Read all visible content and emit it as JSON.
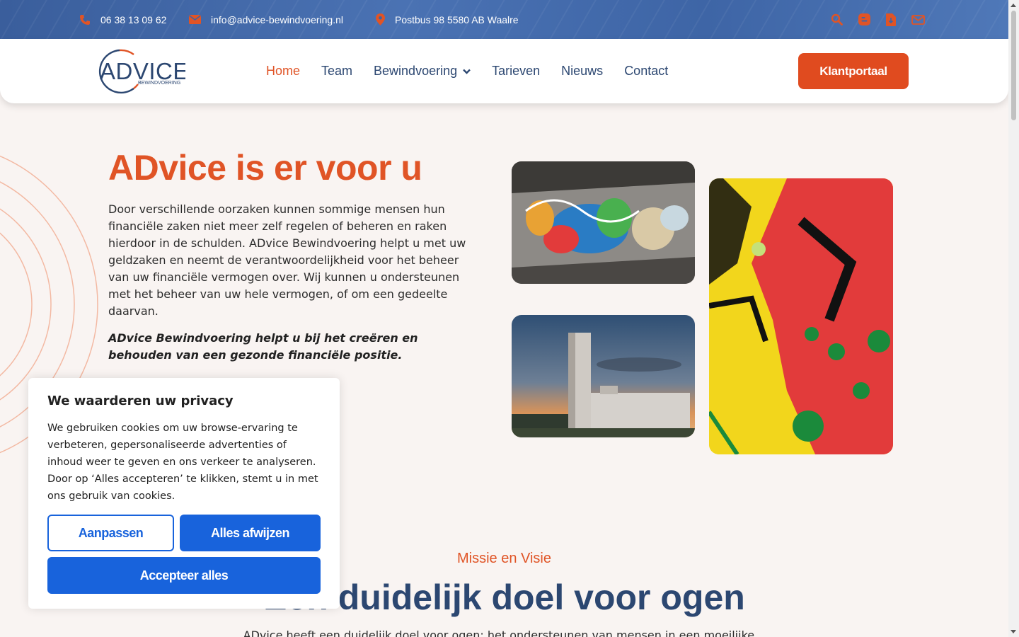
{
  "topbar": {
    "phone": "06 38 13 09 62",
    "email": "info@advice-bewindvoering.nl",
    "address": "Postbus 98 5580 AB Waalre",
    "icons": [
      "search-icon",
      "blogger-icon",
      "file-icon",
      "mail-icon"
    ]
  },
  "header": {
    "logo_text": "ADVICE",
    "logo_subtext": "BEWINDVOERING",
    "nav": {
      "home": "Home",
      "team": "Team",
      "bewindvoering": "Bewindvoering",
      "tarieven": "Tarieven",
      "nieuws": "Nieuws",
      "contact": "Contact"
    },
    "portal_button": "Klantportaal"
  },
  "hero": {
    "title": "ADvice is er voor u",
    "text": "Door verschillende oorzaken kunnen sommige mensen hun financiële zaken niet meer zelf regelen of beheren en raken hierdoor in de schulden. ADvice Bewindvoering helpt u met uw geldzaken en neemt de verantwoordelijkheid voor het beheer van uw financiële vermogen over. Wij kunnen u ondersteunen met het beheer van uw hele vermogen, of om een gedeelte daarvan.",
    "emphasis": "ADvice Bewindvoering helpt u bij het creëren en behouden van een gezonde financiële positie."
  },
  "mission": {
    "subtitle": "Missie en Visie",
    "title": "Een duidelijk doel voor ogen",
    "text": "ADvice heeft een duidelijk doel voor ogen: het ondersteunen van mensen in een moeilijke..."
  },
  "cookie": {
    "title": "We waarderen uw privacy",
    "text": "We gebruiken cookies om uw browse-ervaring te verbeteren, gepersonaliseerde advertenties of inhoud weer te geven en ons verkeer te analyseren. Door op ‘Alles accepteren’ te klikken, stemt u in met ons gebruik van cookies.",
    "customize": "Aanpassen",
    "reject": "Alles afwijzen",
    "accept": "Accepteer alles"
  },
  "colors": {
    "accent": "#e05426",
    "navy": "#2c4771",
    "cookie_blue": "#1863dc",
    "topbar": "#3a5e9c"
  }
}
